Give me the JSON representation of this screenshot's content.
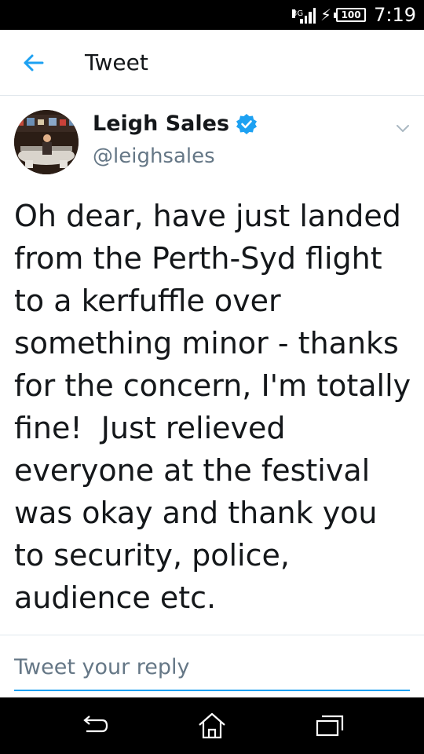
{
  "status_bar": {
    "network": "3G",
    "battery": "100",
    "time": "7:19",
    "icons": [
      "signal-icon",
      "charging-icon",
      "battery-icon"
    ]
  },
  "header": {
    "title": "Tweet",
    "back_icon": "arrow-left-icon"
  },
  "tweet": {
    "author_name": "Leigh Sales",
    "handle": "@leighsales",
    "verified": true,
    "verified_icon": "verified-badge-icon",
    "menu_icon": "chevron-down-icon",
    "text": "Oh dear, have just landed from the Perth-Syd flight to a kerfuffle over something minor - thanks for the concern, I'm totally fine!  Just relieved everyone at the festival was okay and thank you to security, police, audience etc."
  },
  "reply": {
    "placeholder": "Tweet your reply"
  },
  "nav_bar": {
    "icons": [
      "back-nav-icon",
      "home-nav-icon",
      "recent-apps-icon"
    ]
  },
  "colors": {
    "accent": "#1da1f2",
    "text": "#14171a",
    "secondary_text": "#657786",
    "divider": "#e1e8ed",
    "system_bar": "#000000"
  }
}
